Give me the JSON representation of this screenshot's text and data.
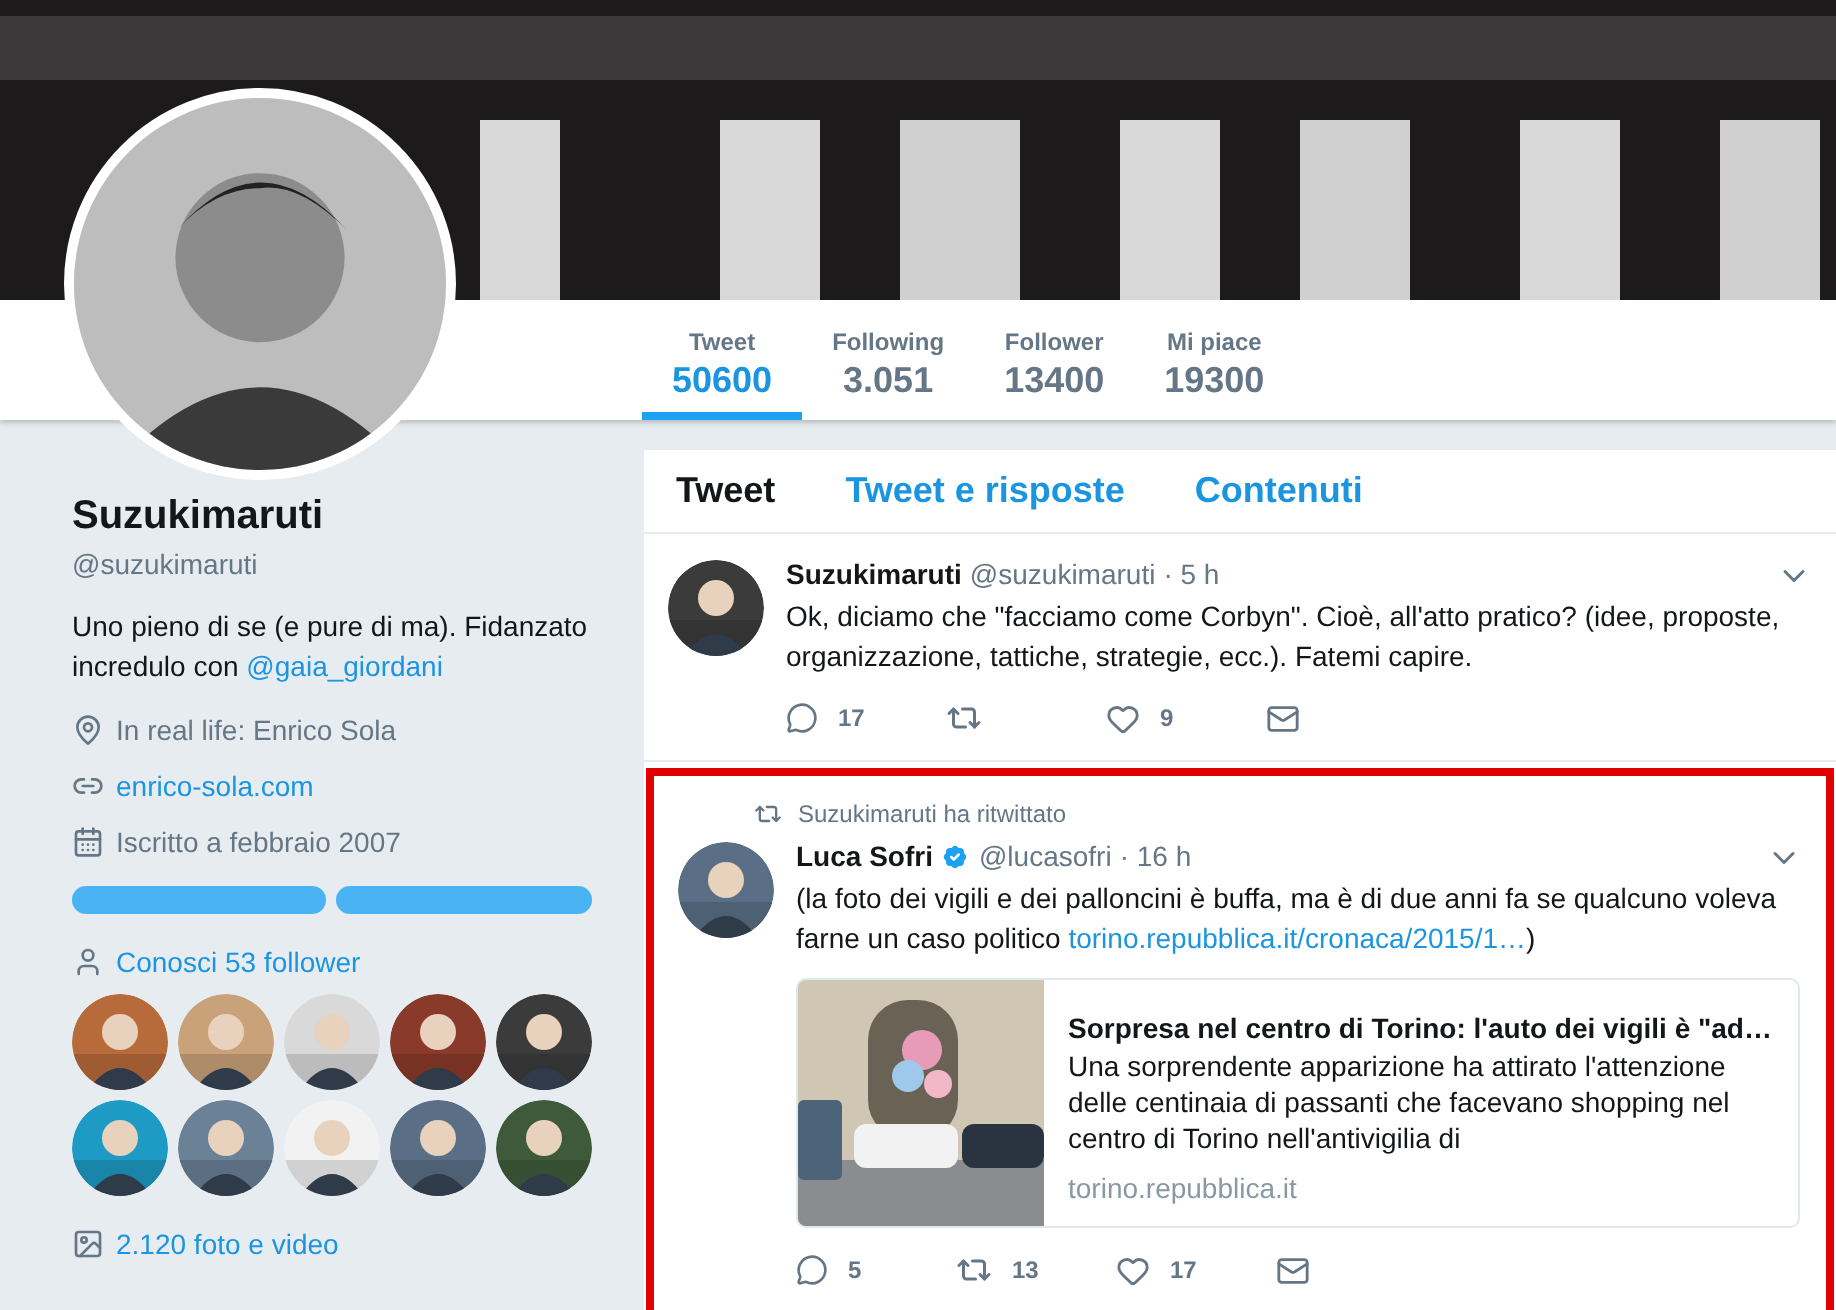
{
  "stats": [
    {
      "label": "Tweet",
      "value": "50600",
      "selected": true
    },
    {
      "label": "Following",
      "value": "3.051",
      "selected": false
    },
    {
      "label": "Follower",
      "value": "13400",
      "selected": false
    },
    {
      "label": "Mi piace",
      "value": "19300",
      "selected": false
    }
  ],
  "profile": {
    "name": "Suzukimaruti",
    "handle": "@suzukimaruti",
    "bio": "Uno pieno di se (e pure di ma). Fidanzato incredulo con ",
    "bio_link": "@gaia_giordani",
    "location": "In real life: Enrico Sola",
    "website": "enrico-sola.com",
    "joined": "Iscritto a febbraio 2007"
  },
  "followers_you_know": {
    "label": "Conosci 53 follower"
  },
  "media": {
    "label": "2.120 foto e video"
  },
  "tabs": [
    {
      "label": "Tweet",
      "selected": true
    },
    {
      "label": "Tweet e risposte",
      "selected": false
    },
    {
      "label": "Contenuti",
      "selected": false
    }
  ],
  "tweets": [
    {
      "highlighted": false,
      "name": "Suzukimaruti",
      "handle": "@suzukimaruti",
      "verified": false,
      "time": "· 5 h",
      "text": "Ok, diciamo che \"facciamo come Corbyn\". Cioè, all'atto pratico? (idee, proposte, organizzazione, tattiche, strategie, ecc.). Fatemi capire.",
      "replies": "17",
      "likes": "9"
    },
    {
      "highlighted": true,
      "retweeted_by": "Suzukimaruti ha ritwittato",
      "name": "Luca Sofri",
      "handle": "@lucasofri",
      "verified": true,
      "time": "· 16 h",
      "text": "(la foto dei vigili e dei palloncini è buffa, ma è di due anni fa se qualcuno voleva farne un caso politico ",
      "link": "torino.repubblica.it/cronaca/2015/1…",
      "text_end": ")",
      "card": {
        "title": "Sorpresa nel centro di Torino: l'auto dei vigili è \"ad…",
        "description": "Una sorprendente apparizione ha attirato l'attenzione delle centinaia di passanti che facevano shopping nel centro di Torino nell'antivigilia di",
        "domain": "torino.repubblica.it"
      },
      "replies": "5",
      "retweets": "13",
      "likes": "17"
    }
  ]
}
